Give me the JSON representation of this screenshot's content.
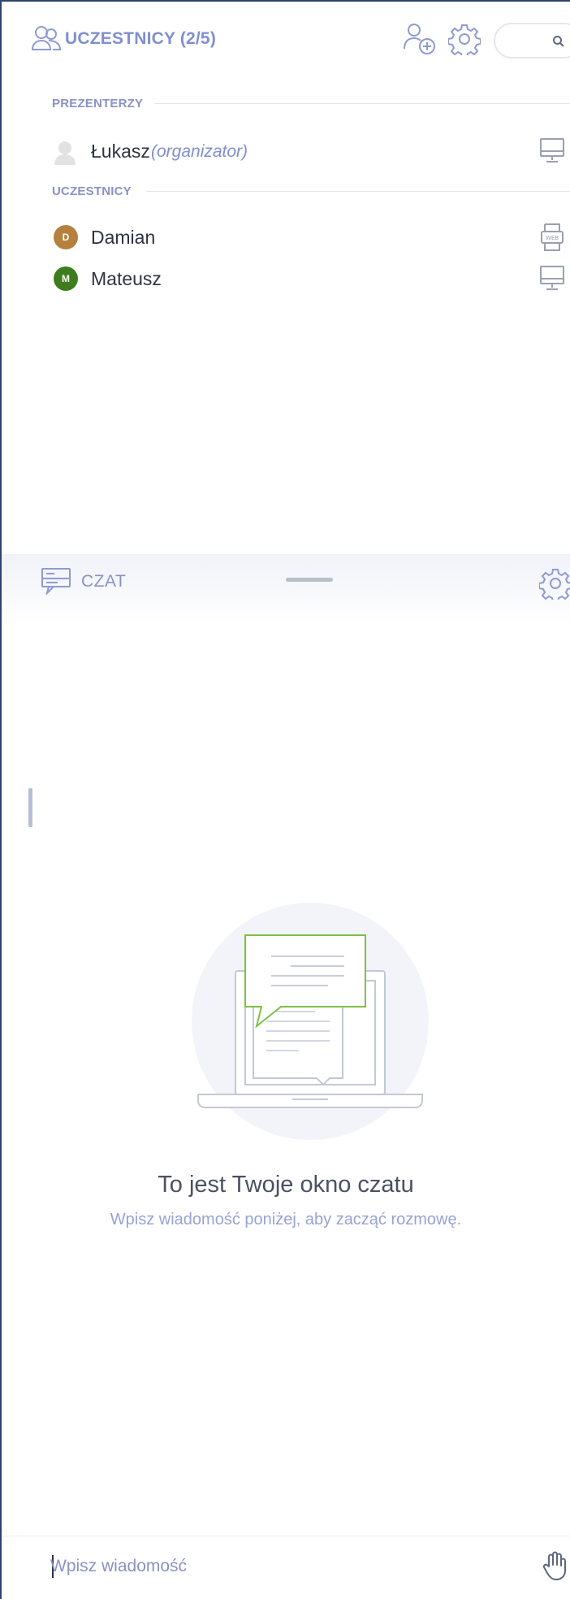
{
  "participants": {
    "title": "UCZESTNICY (2/5)",
    "icons": {
      "header": "people-icon",
      "add": "add-user-icon",
      "settings": "gear-icon",
      "search": "search-icon"
    },
    "sections": [
      {
        "label": "PREZENTERZY",
        "people": [
          {
            "name": "Łukasz",
            "role": "(organizator)",
            "avatar_letter": "",
            "avatar_color": "#e2e2e2",
            "device_icon": "desktop-icon"
          }
        ]
      },
      {
        "label": "UCZESTNICY",
        "people": [
          {
            "name": "Damian",
            "role": "",
            "avatar_letter": "D",
            "avatar_color": "#b5803e",
            "device_icon": "web-browser-icon"
          },
          {
            "name": "Mateusz",
            "role": "",
            "avatar_letter": "M",
            "avatar_color": "#3e7d1e",
            "device_icon": "desktop-icon"
          }
        ]
      }
    ]
  },
  "chat": {
    "title": "CZAT",
    "icons": {
      "header": "chat-icon",
      "settings": "gear-icon",
      "illustration": "laptop-chat-illustration",
      "raise_hand": "raise-hand-icon"
    },
    "empty_title": "To jest Twoje okno czatu",
    "empty_subtitle": "Wpisz wiadomość poniżej, aby zacząć rozmowę.",
    "input_placeholder": "Wpisz wiadomość",
    "input_value": ""
  },
  "colors": {
    "accent": "#7f8fd0",
    "illustration_green": "#7dc142",
    "frame_border": "#2e4470"
  }
}
